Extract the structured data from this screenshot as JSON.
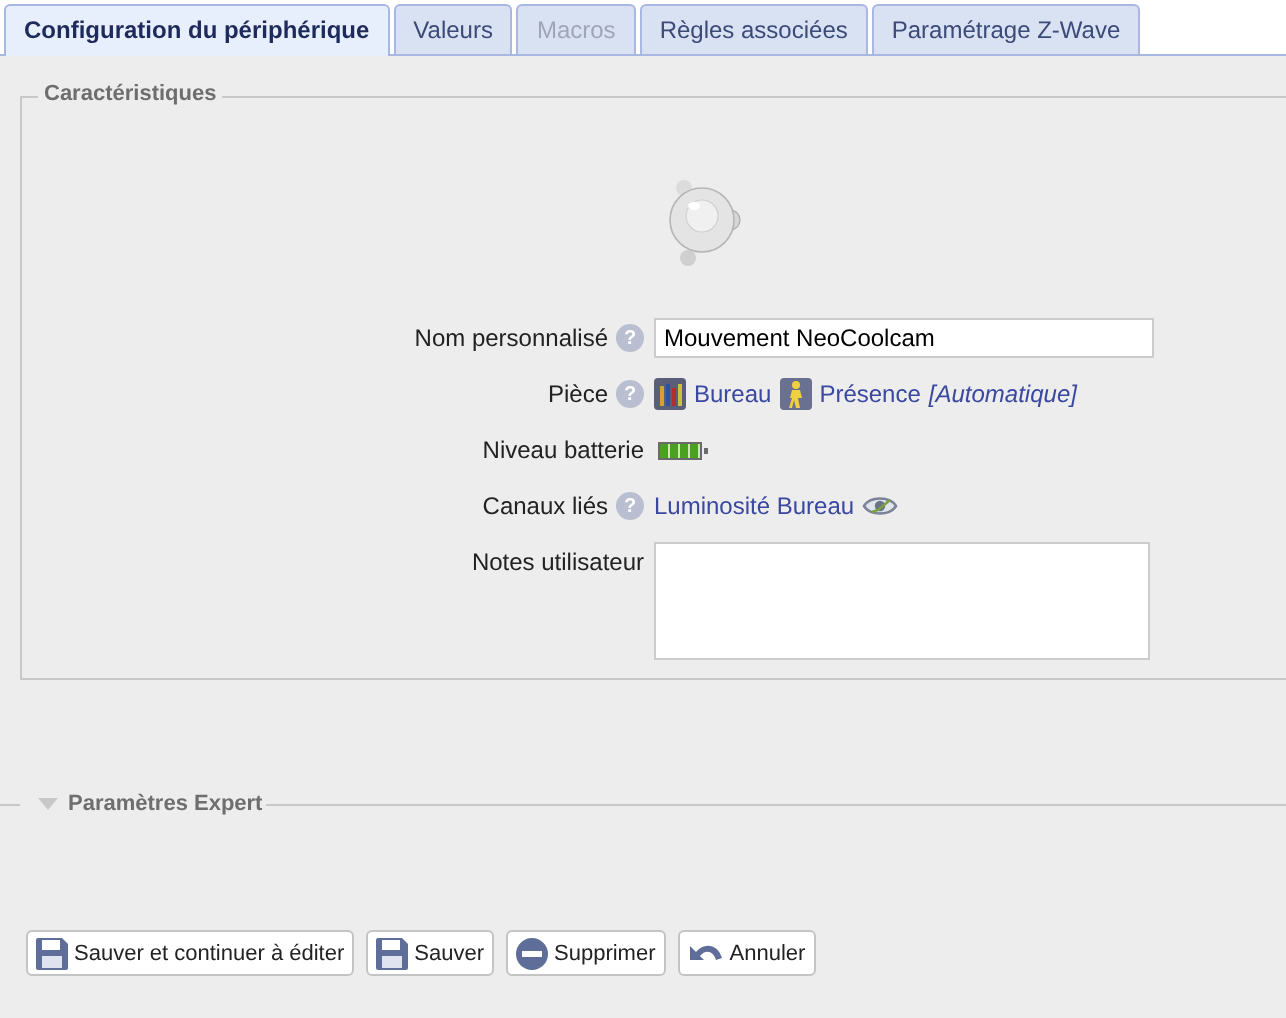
{
  "tabs": [
    {
      "label": "Configuration du périphérique",
      "selected": true,
      "disabled": false
    },
    {
      "label": "Valeurs",
      "selected": false,
      "disabled": false
    },
    {
      "label": "Macros",
      "selected": false,
      "disabled": true
    },
    {
      "label": "Règles associées",
      "selected": false,
      "disabled": false
    },
    {
      "label": "Paramétrage Z-Wave",
      "selected": false,
      "disabled": false
    }
  ],
  "characteristics": {
    "legend": "Caractéristiques",
    "fields": [
      {
        "kind": "text",
        "label": "Nom personnalisé",
        "help": "?",
        "value": "Mouvement NeoCoolcam"
      },
      {
        "kind": "room",
        "label": "Pièce",
        "help": "?",
        "room": "Bureau",
        "mode": "Présence",
        "mode_note": "[Automatique]"
      },
      {
        "kind": "battery",
        "label": "Niveau batterie",
        "level": 1.0
      },
      {
        "kind": "links",
        "label": "Canaux liés",
        "help": "?",
        "link": "Luminosité Bureau"
      },
      {
        "kind": "textarea",
        "label": "Notes utilisateur"
      }
    ]
  },
  "expert": {
    "legend": "Paramètres Expert",
    "expanded": false
  },
  "buttons": [
    {
      "kind": "save-continue",
      "label": "Sauver et continuer à éditer"
    },
    {
      "kind": "save",
      "label": "Sauver"
    },
    {
      "kind": "delete",
      "label": "Supprimer"
    },
    {
      "kind": "cancel",
      "label": "Annuler"
    }
  ]
}
